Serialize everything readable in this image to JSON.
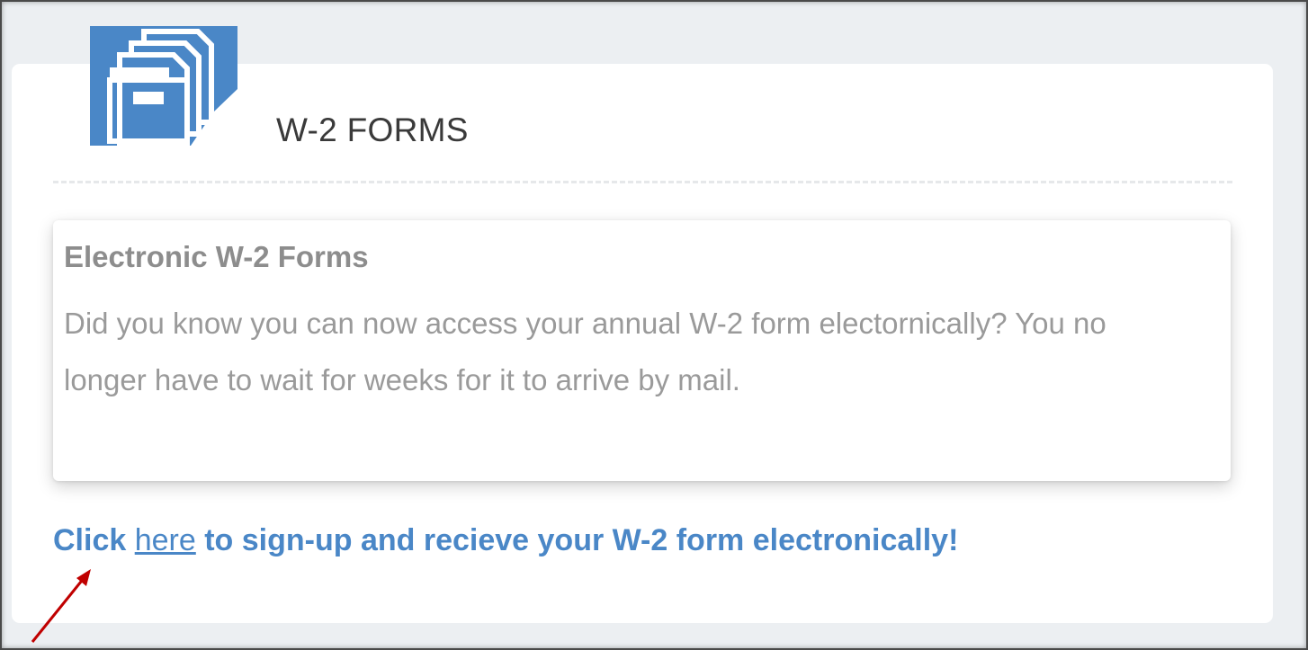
{
  "header": {
    "title": "W-2 FORMS",
    "icon": "file-drawer-icon"
  },
  "info_box": {
    "heading": "Electronic W-2 Forms",
    "body": "Did you know you can now access your annual W-2 form electornically? You no longer have to wait for weeks for it to arrive by mail."
  },
  "cta": {
    "prefix": "Click ",
    "link_label": "here",
    "suffix": " to sign-up and recieve your W-2 form electronically!"
  },
  "annotation": {
    "icon": "red-arrow-pointer"
  },
  "colors": {
    "accent": "#4a87c7",
    "annotation_arrow": "#c00000"
  }
}
